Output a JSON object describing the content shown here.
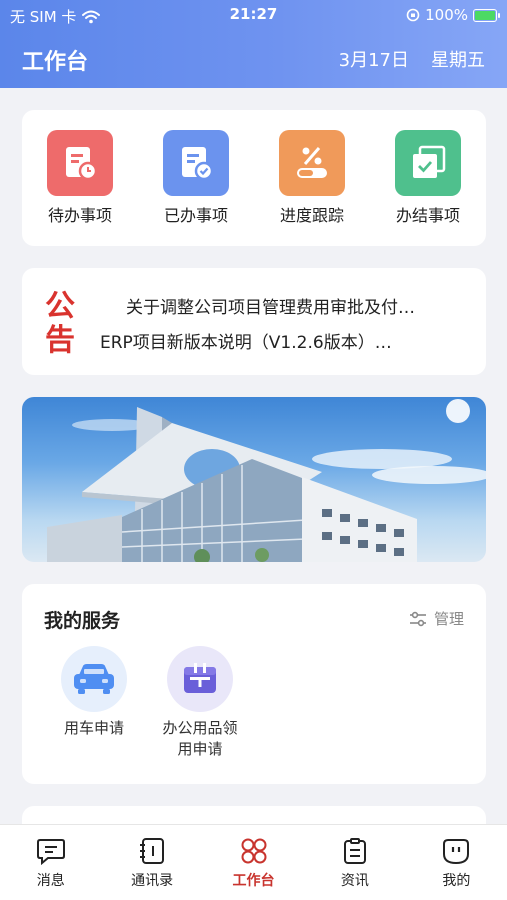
{
  "status_bar": {
    "carrier": "无 SIM 卡",
    "time": "21:27",
    "battery": "100%",
    "battery_level": 1.0
  },
  "header": {
    "title": "工作台",
    "date": "3月17日",
    "weekday": "星期五"
  },
  "quick_actions": [
    {
      "label": "待办事项",
      "icon": "clipboard-clock-icon",
      "color": "#ee6b6b"
    },
    {
      "label": "已办事项",
      "icon": "clipboard-check-icon",
      "color": "#6b93ee"
    },
    {
      "label": "进度跟踪",
      "icon": "percent-progress-icon",
      "color": "#f09a5a"
    },
    {
      "label": "办结事项",
      "icon": "checkbox-stack-icon",
      "color": "#4fc08d"
    }
  ],
  "notice": {
    "badge": [
      "公",
      "告"
    ],
    "items": [
      "关于调整公司项目管理费用审批及付…",
      "ERP项目新版本说明（V1.2.6版本）…"
    ]
  },
  "services": {
    "title": "我的服务",
    "manage_label": "管理",
    "items": [
      {
        "label": "用车申请",
        "icon": "car-icon",
        "color": "#4f8ef2"
      },
      {
        "label": "办公用品领用申请",
        "label_lines": [
          "办公用品领",
          "用申请"
        ],
        "icon": "office-supplies-icon",
        "color": "#6a5fd9"
      }
    ]
  },
  "tabbar": [
    {
      "label": "消息",
      "icon": "message-icon",
      "active": false
    },
    {
      "label": "通讯录",
      "icon": "contacts-icon",
      "active": false
    },
    {
      "label": "工作台",
      "icon": "workbench-icon",
      "active": true
    },
    {
      "label": "资讯",
      "icon": "news-icon",
      "active": false
    },
    {
      "label": "我的",
      "icon": "profile-icon",
      "active": false
    }
  ]
}
